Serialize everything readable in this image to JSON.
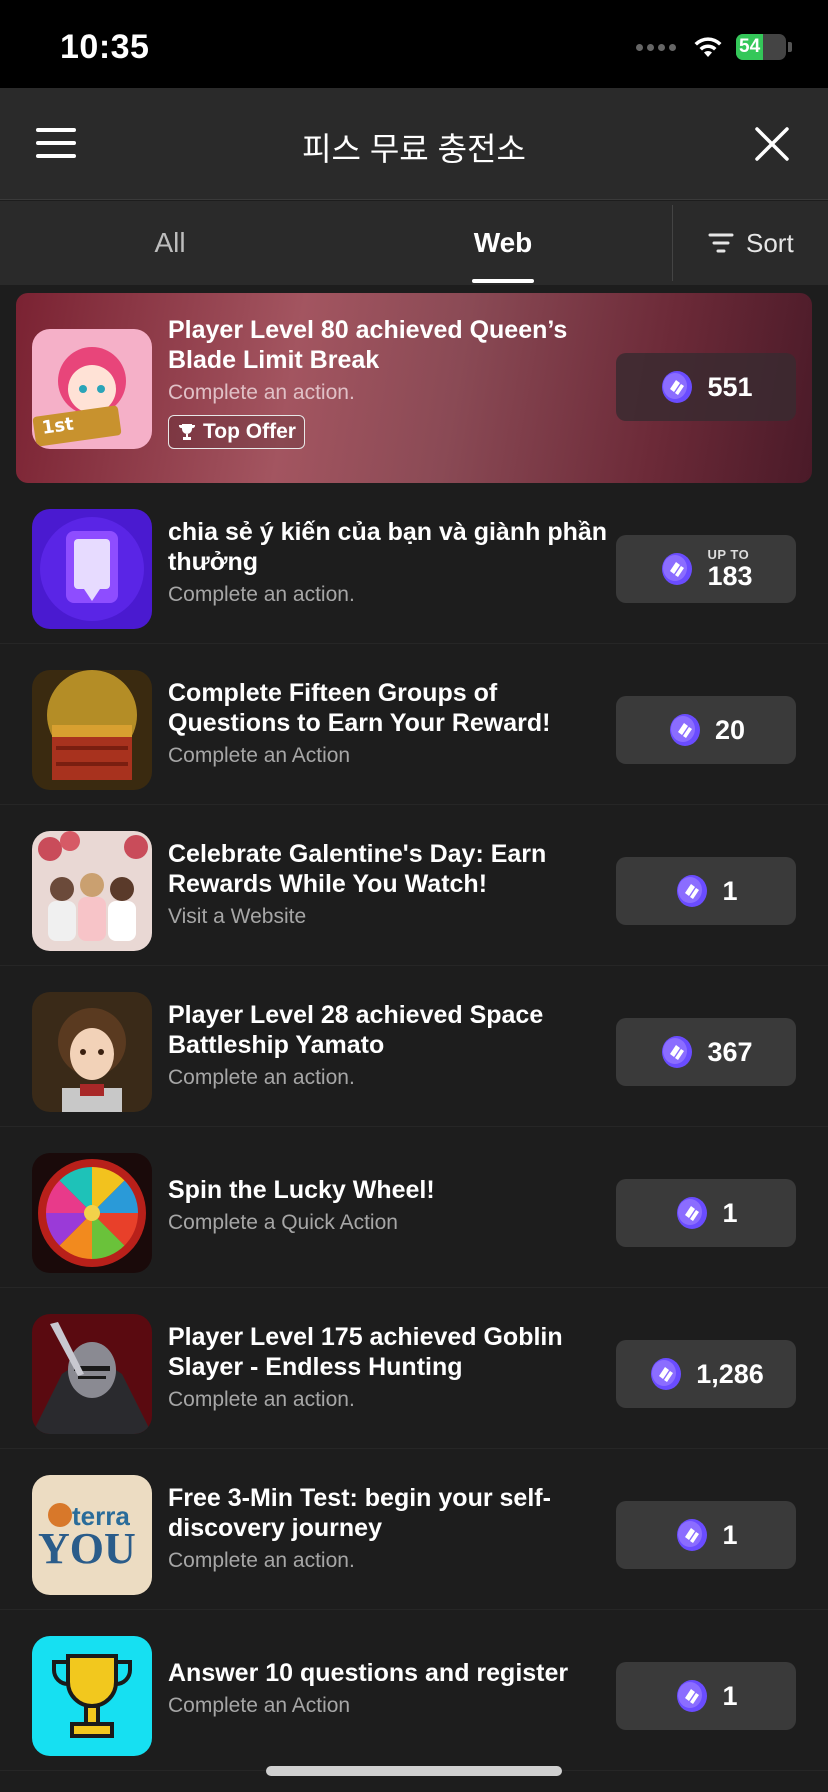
{
  "status_bar": {
    "time": "10:35",
    "battery": "54",
    "battery_level": 0.54,
    "icons": [
      "cellular-icon",
      "wifi-icon",
      "battery-icon"
    ]
  },
  "header": {
    "title": "피스 무료 충전소",
    "menu_icon": "hamburger-icon",
    "close_icon": "close-icon"
  },
  "tabs": [
    {
      "label": "All",
      "selected": false
    },
    {
      "label": "Web",
      "selected": true
    }
  ],
  "sort": {
    "label": "Sort",
    "icon": "sort-icon"
  },
  "colors": {
    "accent_coin": "#6a4cff",
    "featured_bg": "#8a3a4a",
    "button_bg": "#3a3a3a",
    "background": "#1d1d1d"
  },
  "offers": [
    {
      "title": "Player Level 80 achieved Queen’s Blade Limit Break",
      "subtitle": "Complete an action.",
      "badge": "Top Offer",
      "reward": "551",
      "upto": "",
      "thumb": "anime-girl-anniversary"
    },
    {
      "title": "chia sẻ ý kiến của bạn và giành phần thưởng",
      "subtitle": "Complete an action.",
      "reward": "183",
      "upto": "UP TO",
      "thumb": "purple-survey"
    },
    {
      "title": "Complete Fifteen Groups of Questions to Earn Your Reward!",
      "subtitle": "Complete an Action",
      "reward": "20",
      "upto": "",
      "thumb": "treasure-chest"
    },
    {
      "title": "Celebrate Galentine's Day: Earn Rewards While You Watch!",
      "subtitle": "Visit a Website",
      "reward": "1",
      "upto": "",
      "thumb": "party-photo"
    },
    {
      "title": "Player Level 28 achieved Space Battleship Yamato",
      "subtitle": "Complete an action.",
      "reward": "367",
      "upto": "",
      "thumb": "anime-boy"
    },
    {
      "title": "Spin the Lucky Wheel!",
      "subtitle": "Complete a Quick Action",
      "reward": "1",
      "upto": "",
      "thumb": "lucky-wheel"
    },
    {
      "title": "Player Level 175 achieved Goblin Slayer - Endless Hunting",
      "subtitle": "Complete an action.",
      "reward": "1,286",
      "upto": "",
      "thumb": "armored-knight"
    },
    {
      "title": "Free 3-Min Test: begin your self-discovery journey",
      "subtitle": "Complete an action.",
      "reward": "1",
      "upto": "",
      "thumb": "terra-you-logo",
      "logo_text_1": "terra",
      "logo_text_2": "YOU"
    },
    {
      "title": "Answer 10 questions and register",
      "subtitle": "Complete an Action",
      "reward": "1",
      "upto": "",
      "thumb": "trophy"
    }
  ]
}
